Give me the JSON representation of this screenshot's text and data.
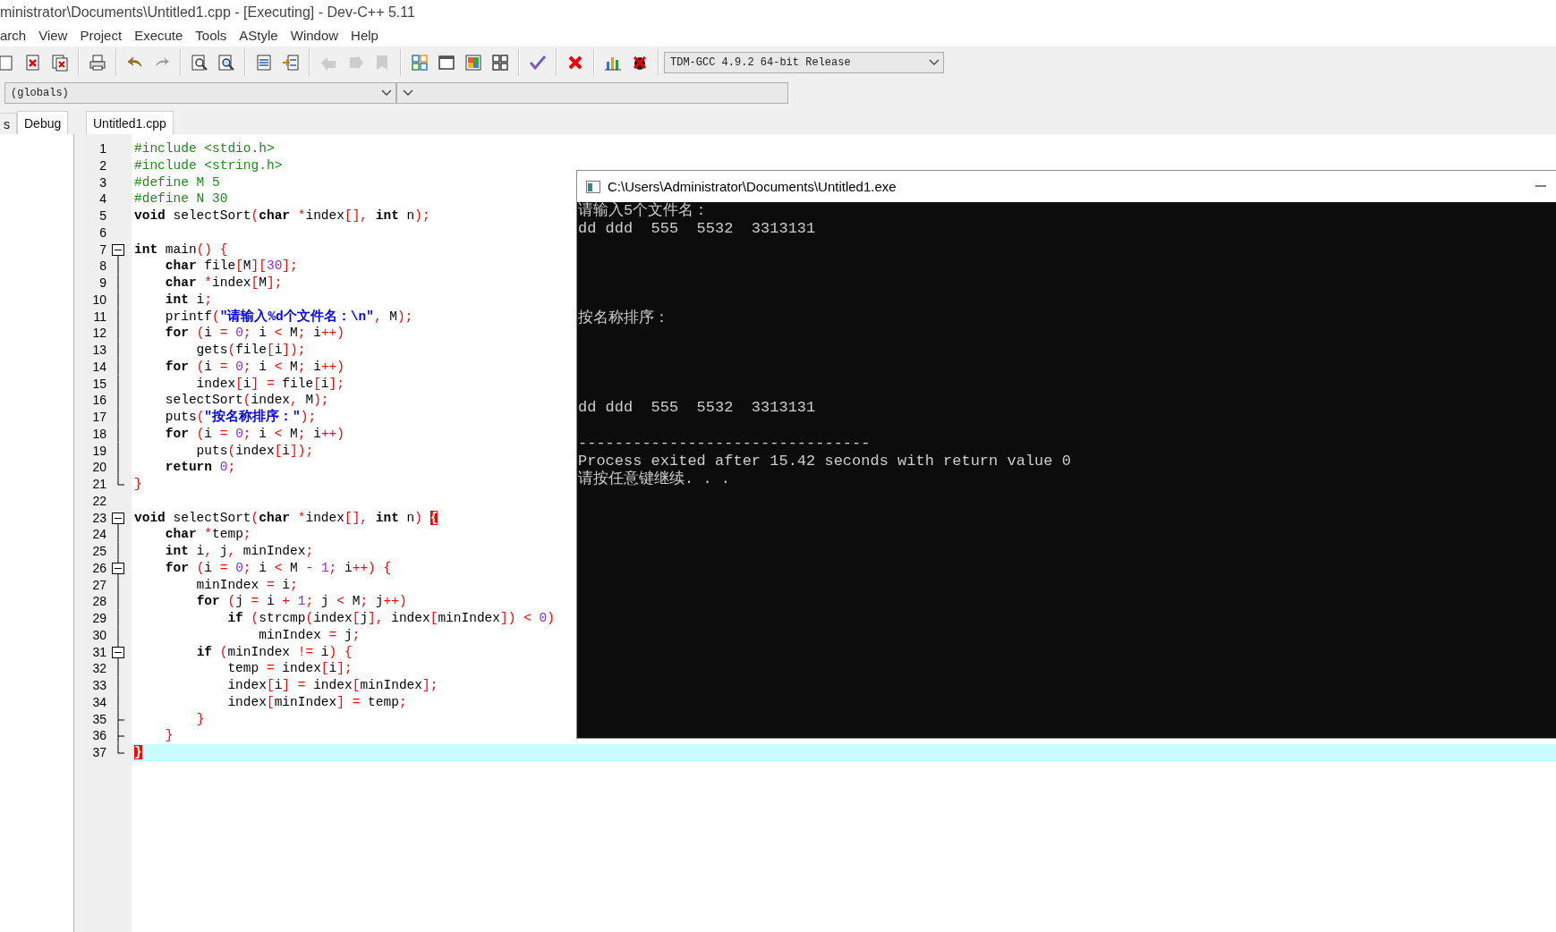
{
  "window": {
    "title": "ministrator\\Documents\\Untitled1.cpp - [Executing] - Dev-C++ 5.11"
  },
  "menu": [
    "arch",
    "View",
    "Project",
    "Execute",
    "Tools",
    "AStyle",
    "Window",
    "Help"
  ],
  "toolbar": [
    [
      {
        "disabled": false
      },
      {
        "disabled": false
      },
      {
        "disabled": false
      }
    ],
    [
      {
        "disabled": false
      }
    ],
    [
      {
        "disabled": false
      },
      {
        "disabled": false
      }
    ],
    [
      {
        "disabled": false
      },
      {
        "disabled": false
      }
    ],
    [
      {
        "disabled": false
      },
      {
        "disabled": false
      }
    ],
    [
      {
        "disabled": true
      },
      {
        "disabled": true
      },
      {
        "disabled": true
      }
    ],
    [
      {
        "disabled": false
      },
      {
        "disabled": false
      },
      {
        "disabled": false
      },
      {
        "disabled": false
      }
    ],
    [
      {
        "disabled": false
      }
    ],
    [
      {
        "disabled": false
      }
    ],
    [
      {
        "disabled": false
      },
      {
        "disabled": false
      }
    ]
  ],
  "compiler": {
    "value": "TDM-GCC 4.9.2 64-bit Release"
  },
  "class_bar": {
    "scope": "(globals)"
  },
  "side_tabs": [
    {
      "label": "s",
      "selected": false
    },
    {
      "label": "Debug",
      "selected": true
    }
  ],
  "editor_tabs": [
    {
      "label": "Untitled1.cpp",
      "selected": true
    }
  ],
  "code_lines": [
    {
      "number": "1",
      "kind": "plain",
      "text": "#include <stdio.h>"
    },
    {
      "number": "2",
      "kind": "plain",
      "text": "#include <string.h>"
    },
    {
      "number": "3",
      "kind": "plain",
      "text": "#define M 5"
    },
    {
      "number": "4",
      "kind": "plain",
      "text": "#define N 30"
    },
    {
      "number": "5",
      "kind": "plain",
      "text": "**void** selectSort(**char** *index[], **int** n);"
    },
    {
      "number": "6",
      "kind": "plain"
    },
    {
      "number": "7",
      "kind": "open",
      "text": "**int** main() {"
    },
    {
      "number": "8",
      "kind": "line",
      "text": "    **char** file[M][30];"
    },
    {
      "number": "9",
      "kind": "line",
      "text": "    **char** *index[M];"
    },
    {
      "number": "10",
      "kind": "line",
      "text": "    **int** i;"
    },
    {
      "number": "11",
      "kind": "line",
      "text": "    printf(\"请输入%d个文件名：\\n\", M);"
    },
    {
      "number": "12",
      "kind": "line",
      "text": "    **for** (i = 0; i < M; i++)"
    },
    {
      "number": "13",
      "kind": "line",
      "text": "        gets(file[i]);"
    },
    {
      "number": "14",
      "kind": "line",
      "text": "    **for** (i = 0; i < M; i++)"
    },
    {
      "number": "15",
      "kind": "line",
      "text": "        index[i] = file[i];"
    },
    {
      "number": "16",
      "kind": "line",
      "text": "    selectSort(index, M);"
    },
    {
      "number": "17",
      "kind": "line",
      "text": "    puts(\"按名称排序：\");"
    },
    {
      "number": "18",
      "kind": "line",
      "text": "    **for** (i = 0; i < M; i++)"
    },
    {
      "number": "19",
      "kind": "line",
      "text": "        puts(index[i]);"
    },
    {
      "number": "20",
      "kind": "line",
      "text": "    **return** 0;"
    },
    {
      "number": "21",
      "kind": "end",
      "text": "}"
    },
    {
      "number": "22",
      "kind": "plain"
    },
    {
      "number": "23",
      "kind": "open",
      "text": "**void** selectSort(**char** *index[], **int** n) {",
      "brace_highlight": true
    },
    {
      "number": "24",
      "kind": "line",
      "text": "    **char** *temp;"
    },
    {
      "number": "25",
      "kind": "line",
      "text": "    **int** i, j, minIndex;"
    },
    {
      "number": "26",
      "kind": "inner",
      "text": "    **for** (i = 0; i < M - 1; i++) {"
    },
    {
      "number": "27",
      "kind": "line",
      "text": "        minIndex = i;"
    },
    {
      "number": "28",
      "kind": "line",
      "text": "        **for** (j = i + 1; j < M; j++)"
    },
    {
      "number": "29",
      "kind": "line",
      "text": "            **if** (strcmp(index[j], index[minIndex]) < 0)"
    },
    {
      "number": "30",
      "kind": "line",
      "text": "                minIndex = j;"
    },
    {
      "number": "31",
      "kind": "inner",
      "text": "        **if** (minIndex != i) {"
    },
    {
      "number": "32",
      "kind": "line",
      "text": "            temp = index[i];"
    },
    {
      "number": "33",
      "kind": "line",
      "text": "            index[i] = index[minIndex];"
    },
    {
      "number": "34",
      "kind": "line",
      "text": "            index[minIndex] = temp;"
    },
    {
      "number": "35",
      "kind": "tee",
      "text": "        }"
    },
    {
      "number": "36",
      "kind": "tee",
      "text": "    }"
    },
    {
      "number": "37",
      "kind": "end",
      "current": true,
      "text": "}",
      "brace_highlight": true
    }
  ],
  "console": {
    "title": "C:\\Users\\Administrator\\Documents\\Untitled1.exe",
    "lines": [
      {
        "kind": "text",
        "text": "请输入5个文件名："
      },
      {
        "kind": "text",
        "text": "dd ddd  555  5532  3313131"
      },
      {
        "kind": "blank"
      },
      {
        "kind": "blank"
      },
      {
        "kind": "blank"
      },
      {
        "kind": "blank"
      },
      {
        "kind": "text",
        "text": "按名称排序："
      },
      {
        "kind": "blank"
      },
      {
        "kind": "blank"
      },
      {
        "kind": "blank"
      },
      {
        "kind": "blank"
      },
      {
        "kind": "text",
        "text": "dd ddd  555  5532  3313131"
      },
      {
        "kind": "blank"
      },
      {
        "kind": "text",
        "text": "--------------------------------"
      },
      {
        "kind": "text",
        "text": "Process exited after 15.42 seconds with return value 0"
      },
      {
        "kind": "text",
        "text": "请按任意键继续. . ."
      }
    ]
  }
}
